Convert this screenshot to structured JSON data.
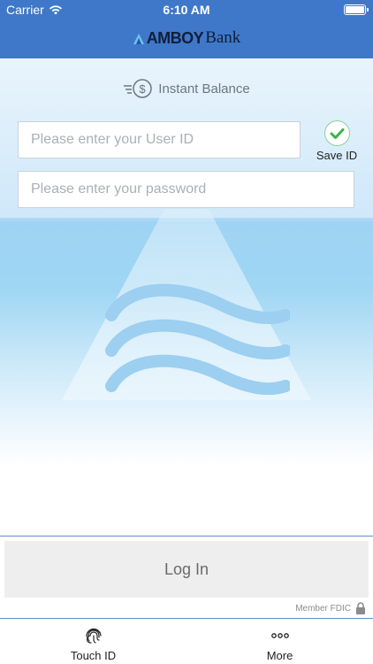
{
  "status_bar": {
    "carrier": "Carrier",
    "time": "6:10 AM"
  },
  "header": {
    "brand_bold": "AMBOY",
    "brand_light": "Bank"
  },
  "instant_balance": {
    "label": "Instant Balance",
    "icon": "dollar-fast-icon"
  },
  "login": {
    "userid_placeholder": "Please enter your User ID",
    "userid_value": "",
    "password_placeholder": "Please enter your password",
    "password_value": "",
    "save_id_label": "Save ID",
    "save_id_checked": true,
    "button_label": "Log In"
  },
  "footer": {
    "member_text": "Member FDIC",
    "icon": "lock-icon"
  },
  "tabbar": {
    "items": [
      {
        "label": "Touch ID",
        "icon": "fingerprint-icon"
      },
      {
        "label": "More",
        "icon": "more-dots-icon"
      }
    ]
  },
  "colors": {
    "header": "#3f78c9",
    "check": "#39b54a",
    "divider": "#5e8fc9"
  }
}
